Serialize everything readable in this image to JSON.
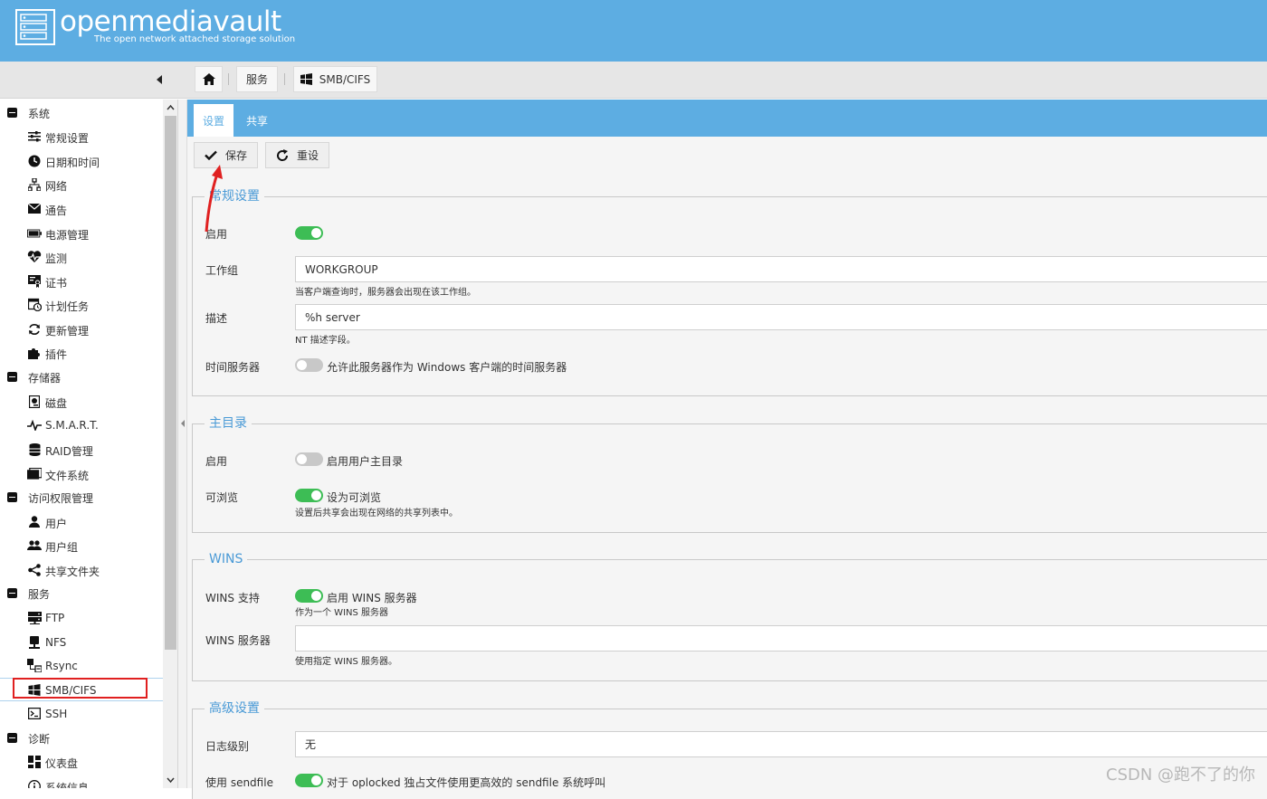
{
  "header": {
    "app_name": "openmediavault",
    "tagline": "The open network attached storage solution",
    "background": "#5dade2"
  },
  "breadcrumb": {
    "home_icon": "home-icon",
    "section": "服务",
    "current": "SMB/CIFS",
    "current_icon": "windows-icon"
  },
  "sidebar": {
    "groups": [
      {
        "label": "系统",
        "items": [
          {
            "label": "常规设置",
            "icon": "sliders-icon"
          },
          {
            "label": "日期和时间",
            "icon": "clock-icon"
          },
          {
            "label": "网络",
            "icon": "network-icon"
          },
          {
            "label": "通告",
            "icon": "envelope-icon"
          },
          {
            "label": "电源管理",
            "icon": "battery-icon"
          },
          {
            "label": "监测",
            "icon": "heartbeat-icon"
          },
          {
            "label": "证书",
            "icon": "certificate-icon"
          },
          {
            "label": "计划任务",
            "icon": "calendar-clock-icon"
          },
          {
            "label": "更新管理",
            "icon": "refresh-icon"
          },
          {
            "label": "插件",
            "icon": "puzzle-icon"
          }
        ]
      },
      {
        "label": "存储器",
        "items": [
          {
            "label": "磁盘",
            "icon": "disk-icon"
          },
          {
            "label": "S.M.A.R.T.",
            "icon": "pulse-icon"
          },
          {
            "label": "RAID管理",
            "icon": "database-icon"
          },
          {
            "label": "文件系统",
            "icon": "folders-icon"
          }
        ]
      },
      {
        "label": "访问权限管理",
        "items": [
          {
            "label": "用户",
            "icon": "user-icon"
          },
          {
            "label": "用户组",
            "icon": "users-icon"
          },
          {
            "label": "共享文件夹",
            "icon": "share-icon"
          }
        ]
      },
      {
        "label": "服务",
        "items": [
          {
            "label": "FTP",
            "icon": "server-icon"
          },
          {
            "label": "NFS",
            "icon": "nfs-icon"
          },
          {
            "label": "Rsync",
            "icon": "rsync-icon"
          },
          {
            "label": "SMB/CIFS",
            "icon": "windows-icon"
          },
          {
            "label": "SSH",
            "icon": "terminal-icon"
          }
        ]
      },
      {
        "label": "诊断",
        "items": [
          {
            "label": "仪表盘",
            "icon": "dashboard-icon"
          },
          {
            "label": "系统信息",
            "icon": "info-icon"
          }
        ]
      }
    ]
  },
  "tabs": [
    {
      "label": "设置",
      "active": true
    },
    {
      "label": "共享",
      "active": false
    }
  ],
  "actions": {
    "save": "保存",
    "reset": "重设"
  },
  "sections": {
    "general": {
      "title": "常规设置",
      "enable_label": "启用",
      "enable_on": true,
      "workgroup_label": "工作组",
      "workgroup_value": "WORKGROUP",
      "workgroup_hint": "当客户端查询时，服务器会出现在该工作组。",
      "desc_label": "描述",
      "desc_value": "%h server",
      "desc_hint": "NT 描述字段。",
      "timeserver_label": "时间服务器",
      "timeserver_on": false,
      "timeserver_text": "允许此服务器作为 Windows 客户端的时间服务器"
    },
    "home": {
      "title": "主目录",
      "enable_label": "启用",
      "enable_on": false,
      "enable_text": "启用用户主目录",
      "browse_label": "可浏览",
      "browse_on": true,
      "browse_text": "设为可浏览",
      "browse_hint": "设置后共享会出现在网络的共享列表中。"
    },
    "wins": {
      "title": "WINS",
      "support_label": "WINS 支持",
      "support_on": true,
      "support_text": "启用 WINS 服务器",
      "support_hint": "作为一个 WINS 服务器",
      "server_label": "WINS 服务器",
      "server_value": "",
      "server_hint": "使用指定 WINS 服务器。"
    },
    "advanced": {
      "title": "高级设置",
      "loglevel_label": "日志级别",
      "loglevel_value": "无",
      "sendfile_label": "使用 sendfile",
      "sendfile_on": true,
      "sendfile_text": "对于 oplocked 独占文件使用更高效的 sendfile 系统呼叫"
    }
  },
  "watermark": "CSDN @跑不了的你",
  "colors": {
    "accent": "#5dade2",
    "toggle_on": "#3dbd55",
    "legend": "#4a9ad6",
    "highlight": "#e02020"
  }
}
